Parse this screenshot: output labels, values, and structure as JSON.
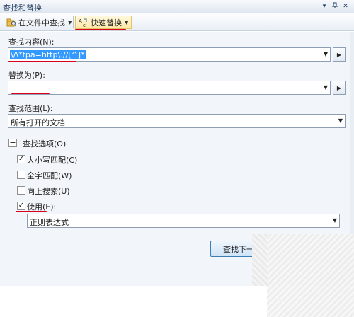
{
  "window": {
    "title": "查找和替换"
  },
  "toolbar": {
    "find_in_files": "在文件中查找",
    "quick_replace": "快速替换"
  },
  "find": {
    "label": "查找内容(N):",
    "value": "\\/\\*tpa=http\\://[^]*"
  },
  "replace": {
    "label": "替换为(P):",
    "value": ""
  },
  "scope": {
    "label": "查找范围(L):",
    "value": "所有打开的文档"
  },
  "options": {
    "header": "查找选项(O)",
    "items": [
      {
        "label": "大小写匹配(C)",
        "checked": true
      },
      {
        "label": "全字匹配(W)",
        "checked": false
      },
      {
        "label": "向上搜索(U)",
        "checked": false
      },
      {
        "label": "使用(E):",
        "checked": true
      }
    ],
    "use_value": "正则表达式"
  },
  "buttons": {
    "find_next": "查找下一"
  },
  "colors": {
    "accent_underline": "#d9001b",
    "selection": "#3399ff"
  }
}
